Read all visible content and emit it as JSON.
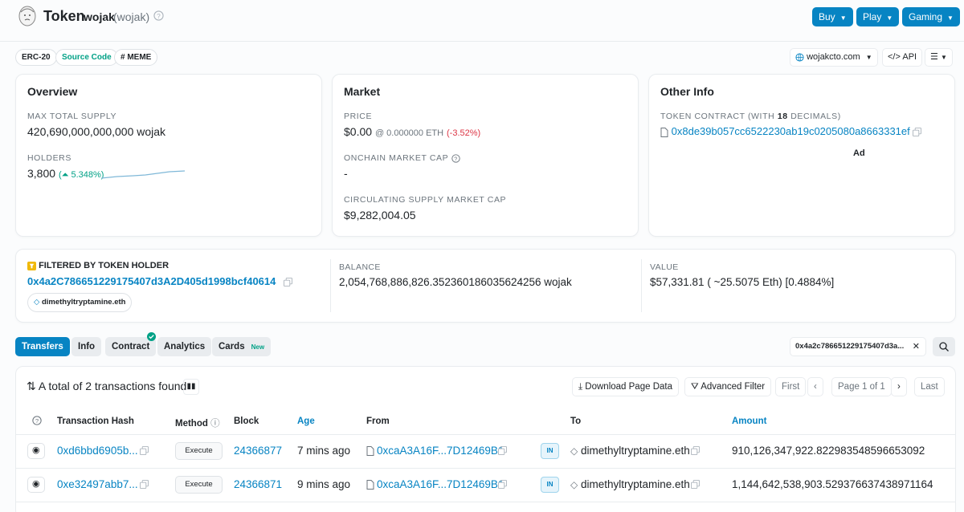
{
  "header": {
    "title": "Token",
    "name": "wojak",
    "symbol": "(wojak)",
    "buttons": [
      "Buy",
      "Play",
      "Gaming"
    ]
  },
  "tags": [
    "ERC-20",
    "Source Code",
    "# MEME"
  ],
  "links": {
    "website": "wojakcto.com",
    "api": "API"
  },
  "overview": {
    "title": "Overview",
    "max_supply_label": "MAX TOTAL SUPPLY",
    "max_supply": "420,690,000,000,000 wojak",
    "holders_label": "HOLDERS",
    "holders": "3,800",
    "holders_change": "5.348%)"
  },
  "market": {
    "title": "Market",
    "price_label": "PRICE",
    "price": "$0.00",
    "price_eth": "@ 0.000000 ETH",
    "price_change": "(-3.52%)",
    "onchain_cap_label": "ONCHAIN MARKET CAP",
    "onchain_cap": "-",
    "circ_cap_label": "CIRCULATING SUPPLY MARKET CAP",
    "circ_cap": "$9,282,004.05"
  },
  "other": {
    "title": "Other Info",
    "contract_label": "TOKEN CONTRACT (WITH",
    "decimals": "18",
    "decimals_suffix": "DECIMALS)",
    "contract": "0x8de39b057cc6522230ab19c0205080a8663331ef",
    "ad": "Ad"
  },
  "filter": {
    "label": "FILTERED BY TOKEN HOLDER",
    "address": "0x4a2C786651229175407d3A2D405d1998bcf40614",
    "ens": "dimethyltryptamine.eth",
    "balance_label": "BALANCE",
    "balance": "2,054,768,886,826.352360186035624256 wojak",
    "value_label": "VALUE",
    "value": "$57,331.81 ( ~25.5075 Eth) [0.4884%]"
  },
  "tabs": [
    "Transfers",
    "Info",
    "Contract",
    "Analytics",
    "Cards"
  ],
  "tab_new": "New",
  "address_filter": "0x4a2c786651229175407d3a...",
  "table": {
    "summary": "A total of 2 transactions found",
    "download": "Download Page Data",
    "advanced": "Advanced Filter",
    "pager": {
      "first": "First",
      "page": "Page 1 of 1",
      "last": "Last"
    },
    "headers": [
      "Transaction Hash",
      "Method",
      "Block",
      "Age",
      "From",
      "To",
      "Amount"
    ],
    "rows": [
      {
        "hash": "0xd6bbd6905b...",
        "method": "Execute",
        "block": "24366877",
        "age": "7 mins ago",
        "from": "0xcaA3A16F...7D12469B1",
        "dir": "IN",
        "to": "dimethyltryptamine.eth",
        "amount": "910,126,347,922.822983548596653092"
      },
      {
        "hash": "0xe32497abb7...",
        "method": "Execute",
        "block": "24366871",
        "age": "9 mins ago",
        "from": "0xcaA3A16F...7D12469B1",
        "dir": "IN",
        "to": "dimethyltryptamine.eth",
        "amount": "1,144,642,538,903.529376637438971164"
      }
    ]
  }
}
